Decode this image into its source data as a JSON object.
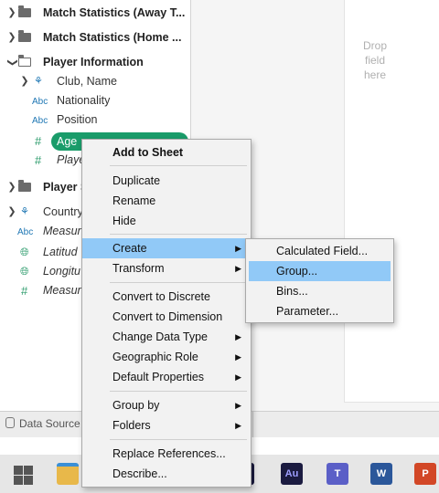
{
  "data_pane": {
    "folders": [
      {
        "label": "Match Statistics (Away T...",
        "expanded": false
      },
      {
        "label": "Match Statistics (Home ...",
        "expanded": false
      },
      {
        "label": "Player Information",
        "expanded": true
      },
      {
        "label": "Player S",
        "expanded": false
      }
    ],
    "fields": {
      "club_name": {
        "label": "Club, Name",
        "icon": "hierarchy-icon"
      },
      "nationality": {
        "label": "Nationality",
        "icon": "Abc"
      },
      "position": {
        "label": "Position",
        "icon": "Abc"
      },
      "age": {
        "label": "Age",
        "icon": "#"
      },
      "player": {
        "label": "Playe",
        "icon": "#"
      },
      "country": {
        "label": "Country",
        "icon": "hierarchy-icon"
      },
      "measure_names": {
        "label": "Measur",
        "icon": "Abc"
      },
      "latitude": {
        "label": "Latitud",
        "icon": "globe-icon"
      },
      "longitude": {
        "label": "Longitu",
        "icon": "globe-icon"
      },
      "measure_values": {
        "label": "Measur",
        "icon": "#"
      }
    }
  },
  "drop_area": {
    "line1": "Drop",
    "line2": "field",
    "line3": "here"
  },
  "tabbar": {
    "data_source": "Data Source"
  },
  "taskbar": {
    "au": "Au",
    "teams": "T",
    "word": "W",
    "ppt": "P"
  },
  "context_menu": {
    "items": [
      {
        "label": "Add to Sheet"
      },
      {
        "label": "Duplicate"
      },
      {
        "label": "Rename"
      },
      {
        "label": "Hide"
      },
      {
        "label": "Create"
      },
      {
        "label": "Transform"
      },
      {
        "label": "Convert to Discrete"
      },
      {
        "label": "Convert to Dimension"
      },
      {
        "label": "Change Data Type"
      },
      {
        "label": "Geographic Role"
      },
      {
        "label": "Default Properties"
      },
      {
        "label": "Group by"
      },
      {
        "label": "Folders"
      },
      {
        "label": "Replace References..."
      },
      {
        "label": "Describe..."
      }
    ]
  },
  "submenu_create": {
    "items": [
      {
        "label": "Calculated Field..."
      },
      {
        "label": "Group..."
      },
      {
        "label": "Bins..."
      },
      {
        "label": "Parameter..."
      }
    ]
  },
  "colors": {
    "pill": "#1a9c6a",
    "highlight": "#91c9f7"
  }
}
